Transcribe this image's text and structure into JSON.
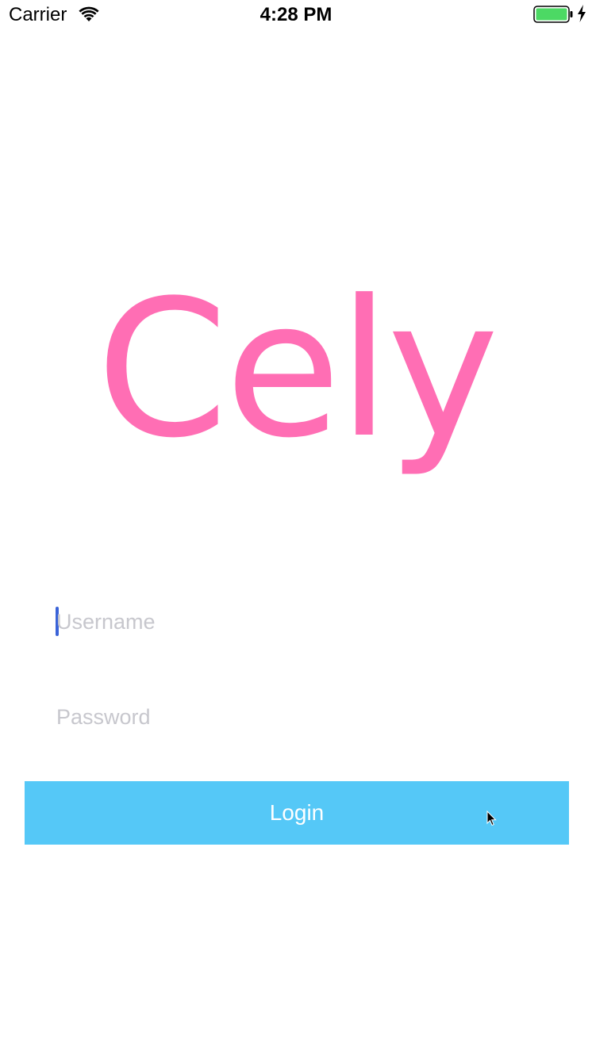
{
  "status_bar": {
    "carrier": "Carrier",
    "time": "4:28 PM",
    "icons": [
      "wifi-icon",
      "battery-icon",
      "charging-icon"
    ],
    "battery_color": "#4cd964"
  },
  "logo": {
    "text": "Cely",
    "color": "#ff6eb4"
  },
  "form": {
    "username_placeholder": "Username",
    "password_placeholder": "Password",
    "caret_color": "#3a63d8",
    "login_label": "Login",
    "button_color": "#55c8f7"
  }
}
